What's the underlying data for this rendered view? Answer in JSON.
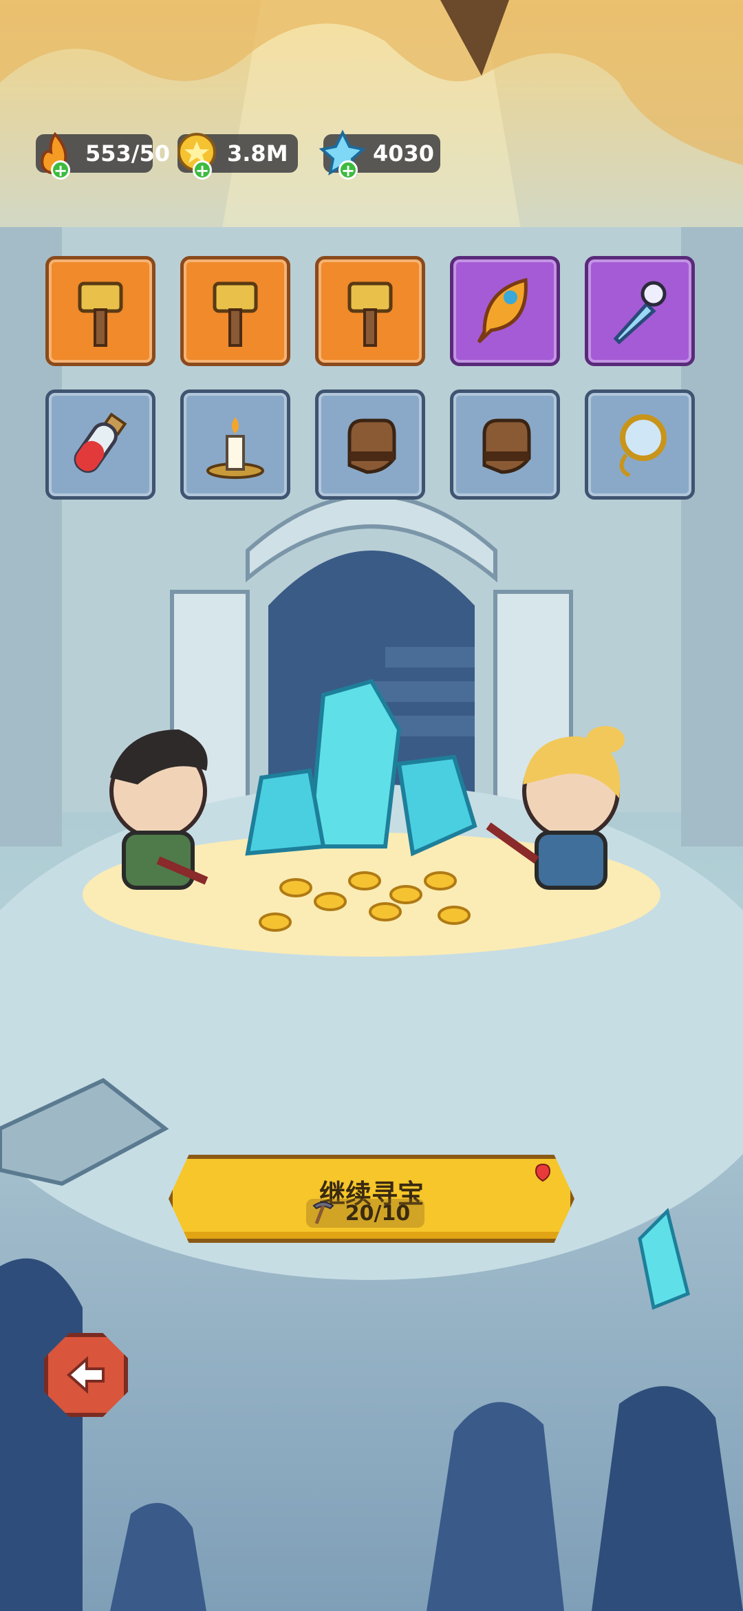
{
  "hud": {
    "energy": {
      "icon": "flame-icon",
      "value": "553/50",
      "plus_icon": "plus-icon"
    },
    "gold": {
      "icon": "gold-coin-icon",
      "value": "3.8M",
      "plus_icon": "plus-icon"
    },
    "crystal": {
      "icon": "ice-crystal-icon",
      "value": "4030",
      "plus_icon": "plus-icon"
    }
  },
  "items": [
    {
      "name": "hammer-icon",
      "rarity": "orange"
    },
    {
      "name": "hammer-icon",
      "rarity": "orange"
    },
    {
      "name": "hammer-icon",
      "rarity": "orange"
    },
    {
      "name": "golden-feather-icon",
      "rarity": "purple"
    },
    {
      "name": "ice-dagger-icon",
      "rarity": "purple"
    },
    {
      "name": "potion-vial-icon",
      "rarity": "blue"
    },
    {
      "name": "candle-icon",
      "rarity": "blue"
    },
    {
      "name": "glove-icon",
      "rarity": "blue"
    },
    {
      "name": "glove-icon",
      "rarity": "blue"
    },
    {
      "name": "magnifier-amulet-icon",
      "rarity": "blue"
    }
  ],
  "cta": {
    "title": "继续寻宝",
    "pickaxe_count": "20/10",
    "icon": "pickaxe-icon",
    "badge": "red-notification-dot"
  },
  "back_button": {
    "icon": "back-arrow-icon"
  },
  "colors": {
    "orange_slot": "#f08a2a",
    "purple_slot": "#a55bd6",
    "blue_slot": "#8aa9c8",
    "cta_yellow": "#f6c62a",
    "back_red": "#d9553b"
  }
}
